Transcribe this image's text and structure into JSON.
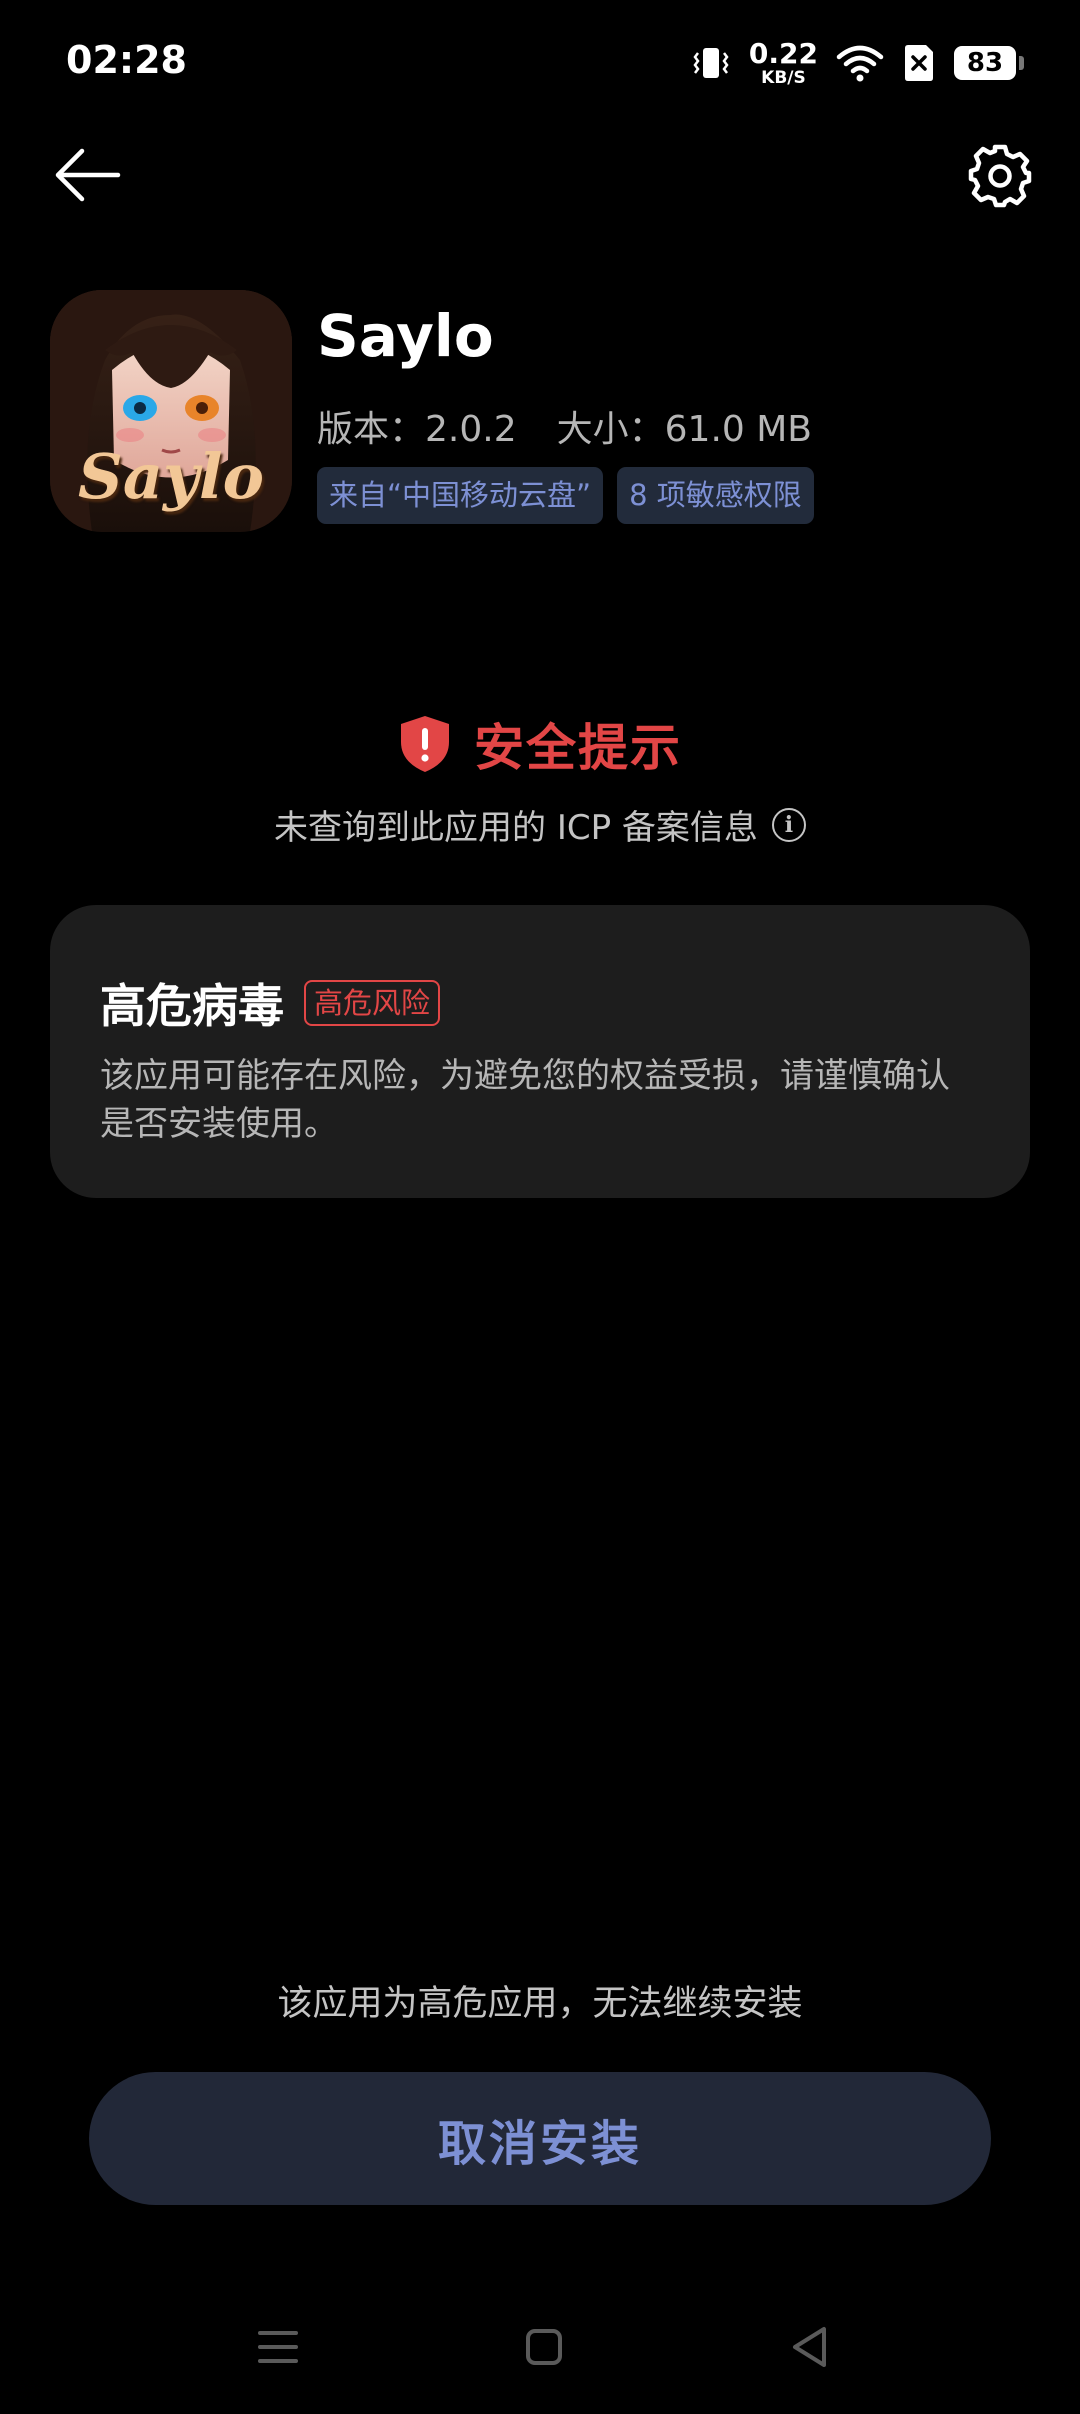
{
  "status_bar": {
    "time": "02:28",
    "net_speed_value": "0.22",
    "net_speed_unit": "KB/S",
    "battery": "83"
  },
  "app": {
    "name": "Saylo",
    "icon_text": "Saylo",
    "version_label": "版本：",
    "version": "2.0.2",
    "size_label": "大小：",
    "size": "61.0 MB",
    "tags": [
      "来自“中国移动云盘”",
      "8 项敏感权限"
    ]
  },
  "security": {
    "title": "安全提示",
    "subtitle": "未查询到此应用的 ICP 备案信息",
    "info_glyph": "i"
  },
  "risk": {
    "title": "高危病毒",
    "badge": "高危风险",
    "description": "该应用可能存在风险，为避免您的权益受损，请谨慎确认是否安装使用。"
  },
  "footer": {
    "note": "该应用为高危应用，无法继续安装",
    "cancel_button": "取消安装"
  },
  "colors": {
    "danger": "#e24646",
    "accent": "#7d90d4",
    "tag_bg": "#222b3b",
    "button_bg": "#222838",
    "card_bg": "#1d1d1d"
  },
  "icons": {
    "back": "arrow-left-icon",
    "settings": "gear-icon",
    "shield": "shield-alert-icon",
    "info": "info-icon",
    "nav_menu": "menu-icon",
    "nav_home": "home-square-icon",
    "nav_back": "back-triangle-icon"
  }
}
